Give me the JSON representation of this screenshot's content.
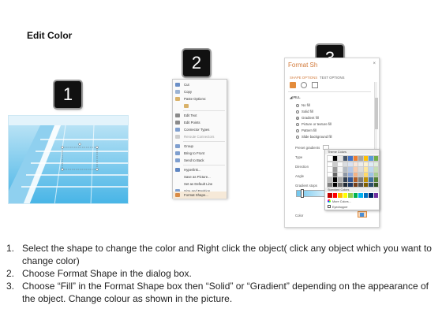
{
  "title": "Edit Color",
  "badges": [
    "1",
    "2",
    "3"
  ],
  "context_menu": {
    "items": [
      "Cut",
      "Copy",
      "Paste Options:",
      "Edit Text",
      "Edit Points",
      "Group",
      "Connector Types",
      "Reroute Connectors",
      "Group",
      "Bring to Front",
      "Send to Back",
      "Hyperlink...",
      "Save as Picture...",
      "Set as Default Line",
      "Size and Position...",
      "Format Shape..."
    ]
  },
  "format_pane": {
    "title": "Format Sh",
    "close": "×",
    "tabs": [
      "SHAPE OPTIONS",
      "TEXT OPTIONS"
    ],
    "section": "FILL",
    "fill_options": [
      "No fill",
      "Solid fill",
      "Gradient fill",
      "Picture or texture fill",
      "Pattern fill",
      "Slide background fill"
    ],
    "selected_fill": "Gradient fill",
    "labels": [
      "Preset gradients",
      "Type",
      "Direction",
      "Angle",
      "Gradient stops",
      "Color"
    ]
  },
  "color_picker": {
    "theme_header": "Theme Colors",
    "standard_header": "Standard Colors",
    "links": [
      "More Colors...",
      "Eyedropper"
    ],
    "theme_top": [
      "#ffffff",
      "#000000",
      "#e7e6e6",
      "#44546a",
      "#4472c4",
      "#ed7d31",
      "#a5a5a5",
      "#ffc000",
      "#5b9bd5",
      "#70ad47"
    ],
    "standard": [
      "#c00000",
      "#ff0000",
      "#ffc000",
      "#ffff00",
      "#92d050",
      "#00b050",
      "#00b0f0",
      "#0070c0",
      "#002060",
      "#7030a0"
    ]
  },
  "instructions": [
    {
      "num": "1.",
      "text": "Select the shape to change the color and Right click the object( click any object which you want to change color)"
    },
    {
      "num": "2.",
      "text": "Choose Format Shape in the dialog box."
    },
    {
      "num": "3.",
      "text": "Choose “Fill” in the Format Shape box then “Solid” or “Gradient” depending on the appearance of the object. Change colour as shown in the picture."
    }
  ]
}
